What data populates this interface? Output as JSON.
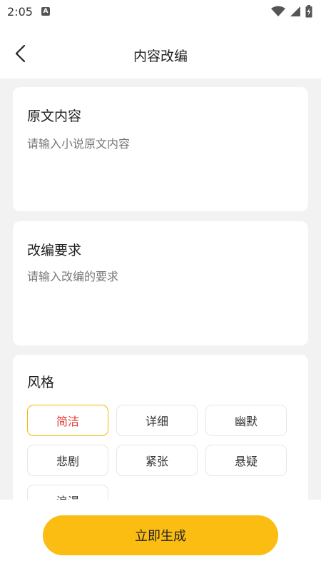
{
  "status_bar": {
    "time": "2:05",
    "notification_icon": "a-badge-icon",
    "notification_label": "A",
    "icons": [
      "wifi-icon",
      "cellular-signal-icon",
      "battery-charging-icon"
    ]
  },
  "header": {
    "back_icon": "chevron-left-icon",
    "title": "内容改编"
  },
  "original_card": {
    "title": "原文内容",
    "placeholder": "请输入小说原文内容",
    "value": ""
  },
  "requirement_card": {
    "title": "改编要求",
    "placeholder": "请输入改编的要求",
    "value": ""
  },
  "style_card": {
    "title": "风格",
    "options": [
      "简洁",
      "详细",
      "幽默",
      "悲剧",
      "紧张",
      "悬疑",
      "浪漫"
    ],
    "selected": "简洁"
  },
  "actions": {
    "generate_label": "立即生成"
  },
  "colors": {
    "accent": "#fbbd12",
    "selected_border": "#f5b800",
    "selected_text": "#e53935",
    "background": "#f2f2f2"
  }
}
